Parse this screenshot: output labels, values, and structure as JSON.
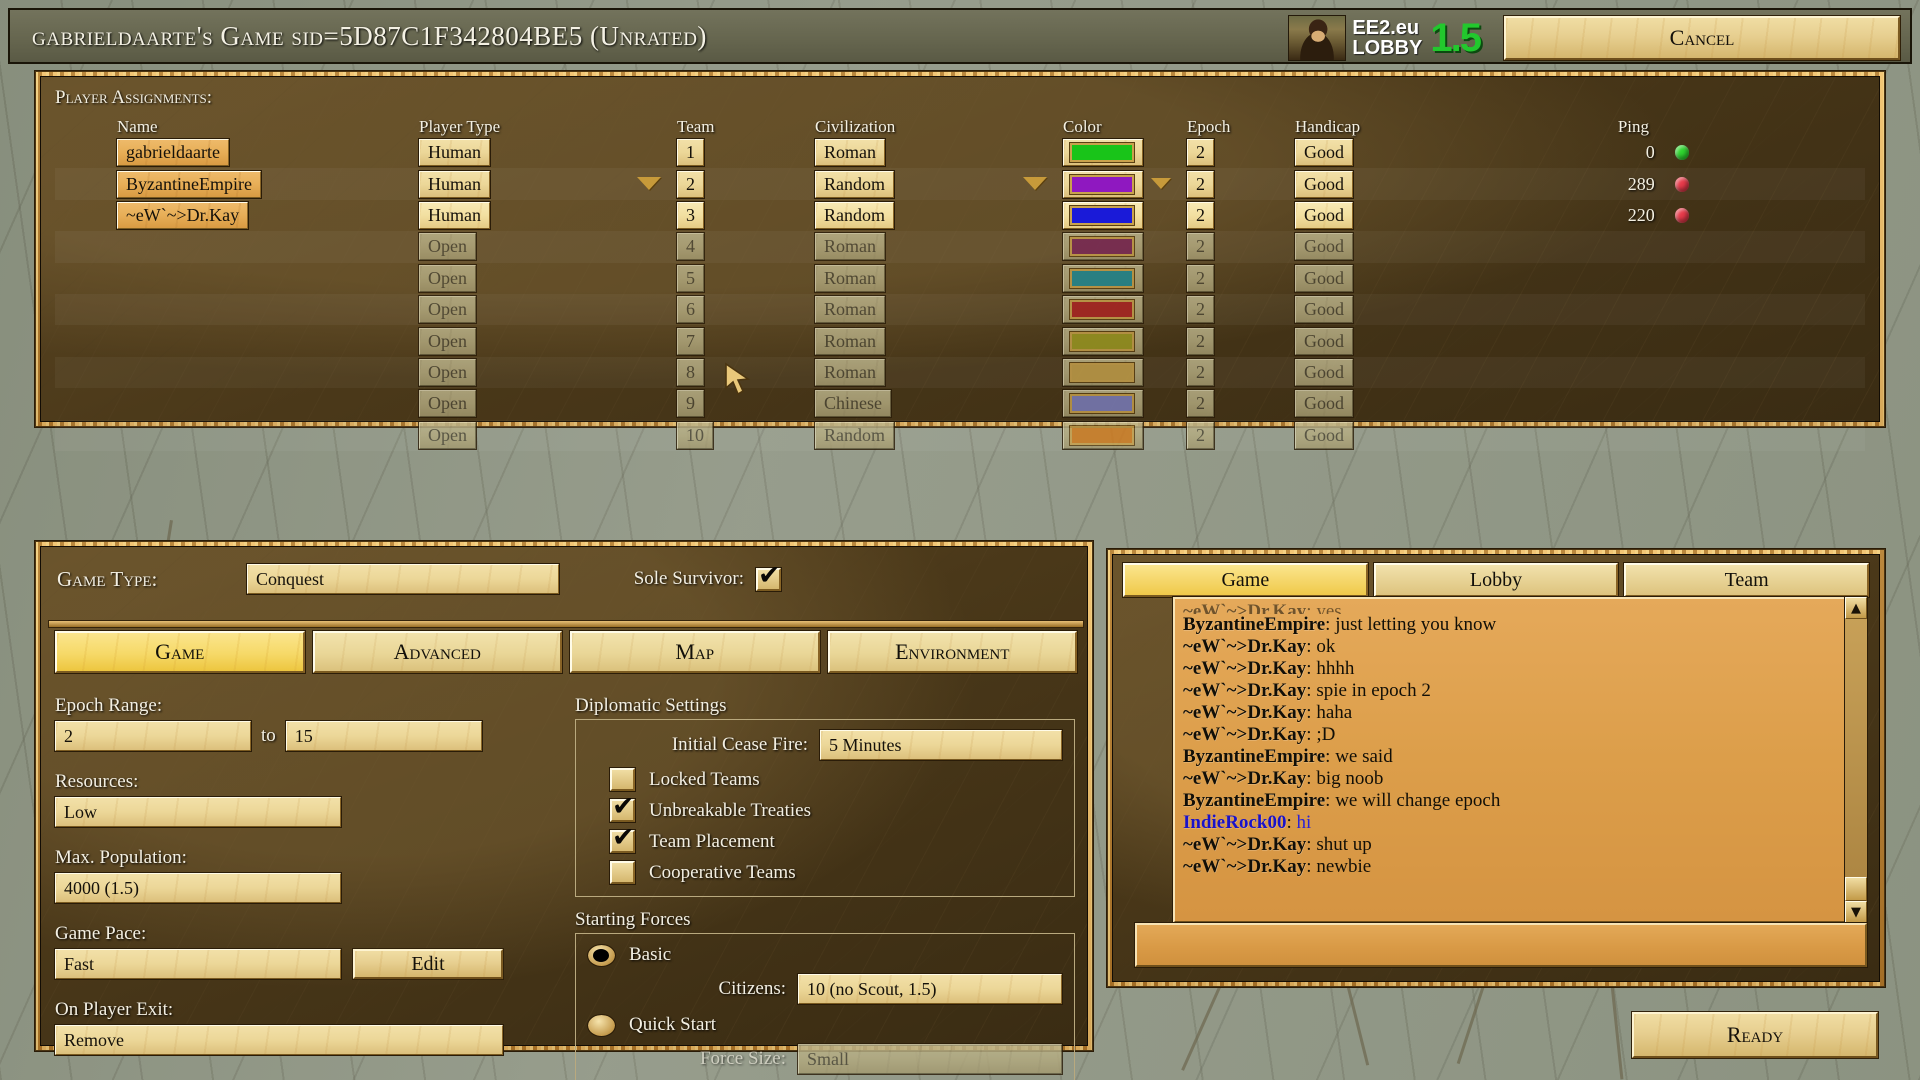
{
  "titlebar": {
    "title": "gabrieldaarte's Game sid=5D87C1F342804BE5 (Unrated)",
    "brand_line1": "EE2.eu",
    "brand_line2": "LOBBY",
    "brand_version": "1.5",
    "cancel_label": "Cancel"
  },
  "players": {
    "section_label": "Player Assignments:",
    "headers": {
      "name": "Name",
      "player_type": "Player Type",
      "team": "Team",
      "civilization": "Civilization",
      "color": "Color",
      "epoch": "Epoch",
      "handicap": "Handicap",
      "ping": "Ping"
    },
    "rows": [
      {
        "name": "gabrieldaarte",
        "type": "Human",
        "team": "1",
        "civ": "Roman",
        "color": "#19c419",
        "epoch": "2",
        "handicap": "Good",
        "ping": "0",
        "status": "#2fd62f",
        "open": false,
        "dropdown": false
      },
      {
        "name": "ByzantineEmpire",
        "type": "Human",
        "team": "2",
        "civ": "Random",
        "color": "#8f18c0",
        "epoch": "2",
        "handicap": "Good",
        "ping": "289",
        "status": "#e83a4a",
        "open": false,
        "dropdown": true
      },
      {
        "name": "~eW`~>Dr.Kay",
        "type": "Human",
        "team": "3",
        "civ": "Random",
        "color": "#1a1ad8",
        "epoch": "2",
        "handicap": "Good",
        "ping": "220",
        "status": "#e83a4a",
        "open": false,
        "dropdown": false
      },
      {
        "name": "",
        "type": "Open",
        "team": "4",
        "civ": "Roman",
        "color": "#7b2757",
        "epoch": "2",
        "handicap": "Good",
        "ping": "",
        "status": "",
        "open": true,
        "dropdown": false
      },
      {
        "name": "",
        "type": "Open",
        "team": "5",
        "civ": "Roman",
        "color": "#1f8c97",
        "epoch": "2",
        "handicap": "Good",
        "ping": "",
        "status": "",
        "open": true,
        "dropdown": false
      },
      {
        "name": "",
        "type": "Open",
        "team": "6",
        "civ": "Roman",
        "color": "#ad2222",
        "epoch": "2",
        "handicap": "Good",
        "ping": "",
        "status": "",
        "open": true,
        "dropdown": false
      },
      {
        "name": "",
        "type": "Open",
        "team": "7",
        "civ": "Roman",
        "color": "#9c9a22",
        "epoch": "2",
        "handicap": "Good",
        "ping": "",
        "status": "",
        "open": true,
        "dropdown": false
      },
      {
        "name": "",
        "type": "Open",
        "team": "8",
        "civ": "Roman",
        "color": "#c3a04a",
        "epoch": "2",
        "handicap": "Good",
        "ping": "",
        "status": "",
        "open": true,
        "dropdown": false
      },
      {
        "name": "",
        "type": "Open",
        "team": "9",
        "civ": "Chinese",
        "color": "#7b7ec0",
        "epoch": "2",
        "handicap": "Good",
        "ping": "",
        "status": "",
        "open": true,
        "dropdown": false
      },
      {
        "name": "",
        "type": "Open",
        "team": "10",
        "civ": "Random",
        "color": "#d07a1c",
        "epoch": "2",
        "handicap": "Good",
        "ping": "",
        "status": "",
        "open": true,
        "dropdown": false
      }
    ]
  },
  "settings": {
    "game_type_label": "Game Type:",
    "game_type_value": "Conquest",
    "sole_survivor_label": "Sole Survivor:",
    "sole_survivor_checked": true,
    "tabs": [
      {
        "label": "Game",
        "active": true
      },
      {
        "label": "Advanced",
        "active": false
      },
      {
        "label": "Map",
        "active": false
      },
      {
        "label": "Environment",
        "active": false
      }
    ],
    "epoch_range_label": "Epoch Range:",
    "epoch_from": "2",
    "epoch_to_label": "to",
    "epoch_to": "15",
    "resources_label": "Resources:",
    "resources_value": "Low",
    "max_population_label": "Max. Population:",
    "max_population_value": "4000 (1.5)",
    "game_pace_label": "Game Pace:",
    "game_pace_value": "Fast",
    "edit_label": "Edit",
    "on_player_exit_label": "On Player Exit:",
    "on_player_exit_value": "Remove",
    "diplomatic": {
      "title": "Diplomatic Settings",
      "cease_fire_label": "Initial Cease Fire:",
      "cease_fire_value": "5 Minutes",
      "options": [
        {
          "label": "Locked Teams",
          "checked": false
        },
        {
          "label": "Unbreakable Treaties",
          "checked": true
        },
        {
          "label": "Team Placement",
          "checked": true
        },
        {
          "label": "Cooperative Teams",
          "checked": false
        }
      ]
    },
    "starting_forces": {
      "title": "Starting Forces",
      "basic_label": "Basic",
      "basic_selected": true,
      "citizens_label": "Citizens:",
      "citizens_value": "10 (no Scout, 1.5)",
      "quick_start_label": "Quick Start",
      "quick_start_selected": false,
      "force_size_label": "Force Size:",
      "force_size_value": "Small"
    }
  },
  "chat": {
    "tabs": [
      {
        "label": "Game",
        "active": true
      },
      {
        "label": "Lobby",
        "active": false
      },
      {
        "label": "Team",
        "active": false
      }
    ],
    "messages": [
      {
        "user": "~eW`~>Dr.Kay",
        "text": "yes",
        "clipped": true,
        "highlight": false
      },
      {
        "user": "ByzantineEmpire",
        "text": "just letting you know",
        "clipped": false,
        "highlight": false
      },
      {
        "user": "~eW`~>Dr.Kay",
        "text": "ok",
        "clipped": false,
        "highlight": false
      },
      {
        "user": "~eW`~>Dr.Kay",
        "text": "hhhh",
        "clipped": false,
        "highlight": false
      },
      {
        "user": "~eW`~>Dr.Kay",
        "text": "spie in epoch 2",
        "clipped": false,
        "highlight": false
      },
      {
        "user": "~eW`~>Dr.Kay",
        "text": "haha",
        "clipped": false,
        "highlight": false
      },
      {
        "user": "~eW`~>Dr.Kay",
        "text": ";D",
        "clipped": false,
        "highlight": false
      },
      {
        "user": "ByzantineEmpire",
        "text": "we said",
        "clipped": false,
        "highlight": false
      },
      {
        "user": "~eW`~>Dr.Kay",
        "text": "big noob",
        "clipped": false,
        "highlight": false
      },
      {
        "user": "ByzantineEmpire",
        "text": "we will change epoch",
        "clipped": false,
        "highlight": false
      },
      {
        "user": "IndieRock00",
        "text": "hi",
        "clipped": false,
        "highlight": true
      },
      {
        "user": "~eW`~>Dr.Kay",
        "text": "shut up",
        "clipped": false,
        "highlight": false
      },
      {
        "user": "~eW`~>Dr.Kay",
        "text": "newbie",
        "clipped": false,
        "highlight": false
      }
    ],
    "input_value": "",
    "scroll_up_icon": "▲",
    "scroll_down_icon": "▼"
  },
  "footer": {
    "ready_label": "Ready"
  }
}
